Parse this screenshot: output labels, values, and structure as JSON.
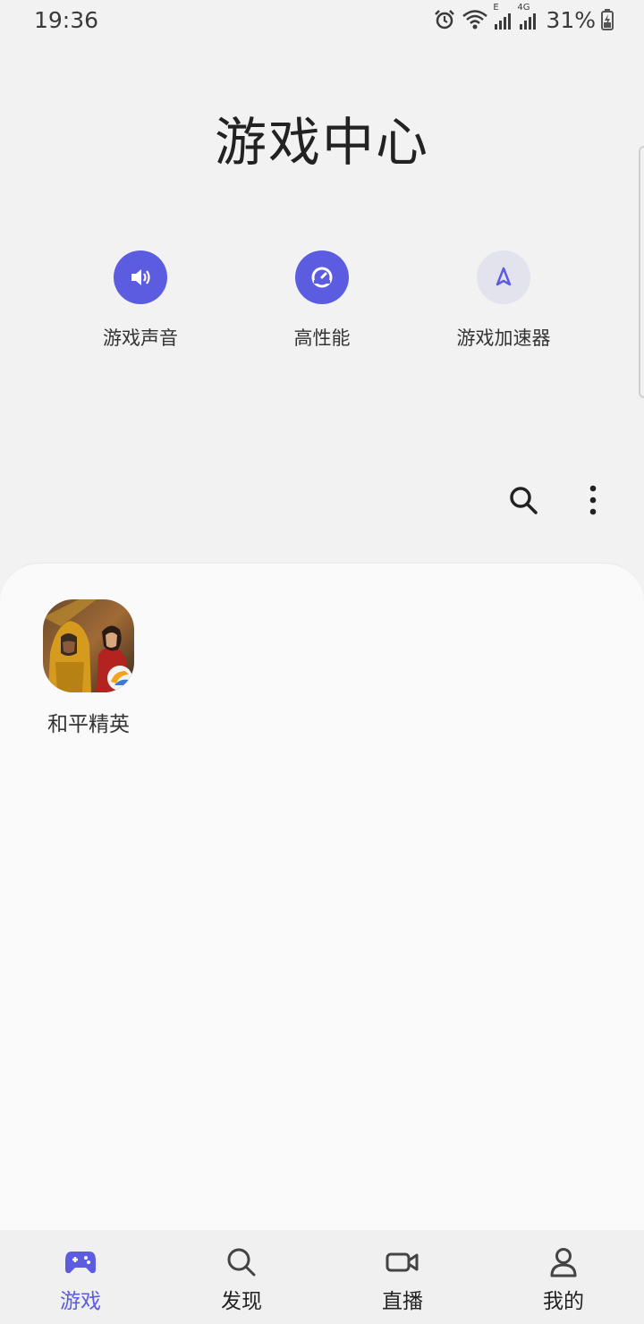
{
  "status_bar": {
    "time": "19:36",
    "battery_percent": "31%",
    "network_label_1": "E",
    "network_label_2": "4G"
  },
  "page": {
    "title": "游戏中心"
  },
  "quick_settings": [
    {
      "label": "游戏声音",
      "icon": "speaker-icon",
      "enabled": true
    },
    {
      "label": "高性能",
      "icon": "performance-gauge-icon",
      "enabled": true
    },
    {
      "label": "游戏加速器",
      "icon": "rocket-icon",
      "enabled": false
    }
  ],
  "toolbar": {
    "search_icon": "search-icon",
    "more_icon": "more-options-icon"
  },
  "games": [
    {
      "name": "和平精英"
    }
  ],
  "bottom_nav": {
    "items": [
      {
        "label": "游戏",
        "icon": "gamepad-icon",
        "active": true
      },
      {
        "label": "发现",
        "icon": "search-icon",
        "active": false
      },
      {
        "label": "直播",
        "icon": "video-camera-icon",
        "active": false
      },
      {
        "label": "我的",
        "icon": "person-icon",
        "active": false
      }
    ]
  },
  "colors": {
    "accent": "#5c5ce0",
    "background": "#f2f2f2",
    "card": "#fafafa"
  }
}
